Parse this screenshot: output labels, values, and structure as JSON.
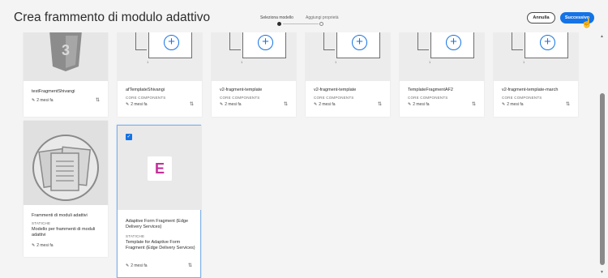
{
  "header": {
    "title": "Crea frammento di modulo adattivo",
    "steps": [
      "Seleziona modello",
      "Aggiungi proprietà"
    ],
    "cancel_label": "Annulla",
    "next_label": "Successivo"
  },
  "cards_row1": [
    {
      "title": "testFragmentShivangi",
      "meta": "",
      "date": "2 mesi fa"
    },
    {
      "title": "afTemplateShivangi",
      "meta": "CORE COMPONENTS",
      "date": "2 mesi fa"
    },
    {
      "title": "v2-fragment-template",
      "meta": "CORE COMPONENTS",
      "date": "2 mesi fa"
    },
    {
      "title": "v2-fragment-template",
      "meta": "CORE COMPONENTS",
      "date": "2 mesi fa"
    },
    {
      "title": "TemplateFragmentAF2",
      "meta": "CORE COMPONENTS",
      "date": "2 mesi fa"
    },
    {
      "title": "v2-fragment-template-march",
      "meta": "CORE COMPONENTS",
      "date": "2 mesi fa"
    }
  ],
  "cards_row2": [
    {
      "title": "Frammenti di moduli adattivi",
      "meta": "STATICHE",
      "desc": "Modello per frammenti di moduli adattivi",
      "date": "2 mesi fa"
    },
    {
      "title": "Adaptive Form Fragment (Edge Delivery Services)",
      "meta": "STATICHE",
      "desc": "Template for Adaptive Form Fragment (Edge Delivery Services)",
      "date": "2 mesi fa",
      "selected": true,
      "logo_letter": "E"
    }
  ],
  "icons": {
    "pencil": "pencil-icon",
    "sync": "sync-icon",
    "add": "add-circle-icon",
    "checkbox": "checkbox-icon"
  },
  "colors": {
    "accent": "#1473e6",
    "logo": "#c4309a"
  }
}
